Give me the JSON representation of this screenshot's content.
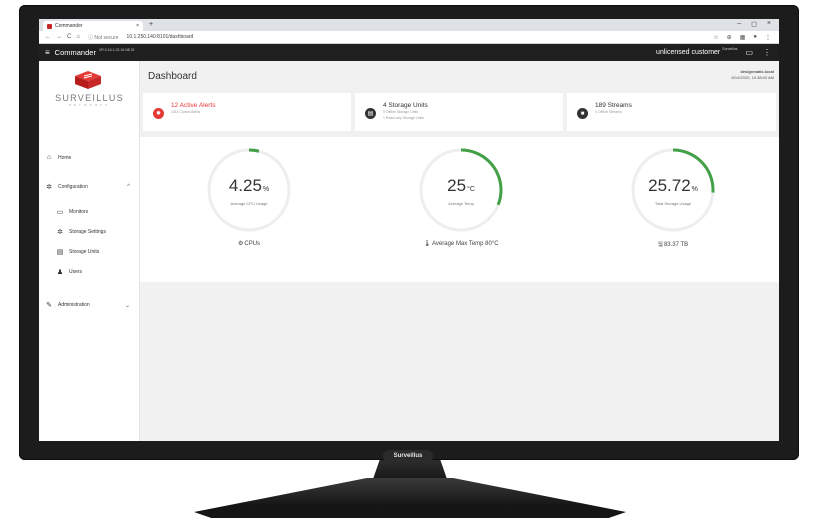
{
  "monitor": {
    "brand": "Surveillus"
  },
  "browser": {
    "tab_title": "Commander",
    "tab_close": "×",
    "new_tab": "+",
    "window_controls": {
      "minimize": "–",
      "maximize": "◻",
      "close": "×"
    },
    "nav": {
      "back": "←",
      "forward": "→",
      "reload": "C",
      "home": "⌂"
    },
    "security_label": "ⓘ Not secure",
    "url": "10.1.250.140:8101/dashboard",
    "toolbar_icons": [
      "☆",
      "⊕",
      "▦",
      "●",
      "⋮"
    ]
  },
  "appbar": {
    "menu_icon": "≡",
    "title": "Commander",
    "version": "VR.0.16.1.23.19.NE.IS",
    "customer": "unlicensed customer",
    "customer_sup": "Surveillus",
    "message_icon": "▭",
    "more_icon": "⋮"
  },
  "sidebar": {
    "brand": "SURVEILLUS",
    "brand_sub": "NETWORKS",
    "home": {
      "icon": "⌂",
      "label": "Home"
    },
    "configuration": {
      "icon": "✲",
      "label": "Configuration",
      "chevron": "^"
    },
    "items": [
      {
        "icon": "▭",
        "label": "Monitors"
      },
      {
        "icon": "✲",
        "label": "Storage Settings"
      },
      {
        "icon": "▤",
        "label": "Storage Units"
      },
      {
        "icon": "♟",
        "label": "Users"
      }
    ],
    "administration": {
      "icon": "✎",
      "label": "Administration",
      "chevron": "⌄"
    }
  },
  "dashboard": {
    "title": "Dashboard",
    "user_name": "designmatic.local",
    "user_date": "8/14/2020, 10:38:00 AM",
    "cards": [
      {
        "icon": "✹",
        "title": "12 Active Alerts",
        "subs": [
          "1011 Closed Alerts"
        ],
        "color": "#e53935",
        "title_color": "#e53935"
      },
      {
        "icon": "▤",
        "title": "4 Storage Units",
        "subs": [
          "0 Offline Storage Units",
          "1 Read-only Storage Units"
        ],
        "color": "#333333",
        "title_color": "#333333"
      },
      {
        "icon": "■",
        "title": "189 Streams",
        "subs": [
          "0 Offline Streams"
        ],
        "color": "#333333",
        "title_color": "#333333"
      }
    ],
    "gauges": [
      {
        "value": "4.25",
        "unit": "%",
        "label": "Average CPU Usage",
        "level": 0.04,
        "footer_icon": "⚙",
        "footer": "CPUs"
      },
      {
        "value": "25",
        "unit": "°C",
        "label": "Average Temp",
        "level": 0.31,
        "footer_icon": "🌡",
        "footer": "Average Max Temp 80°C"
      },
      {
        "value": "25.72",
        "unit": "%",
        "label": "Total Storage Usage",
        "level": 0.26,
        "footer_icon": "🖫",
        "footer": "83.37 TB"
      }
    ],
    "accent": "#43a047"
  }
}
